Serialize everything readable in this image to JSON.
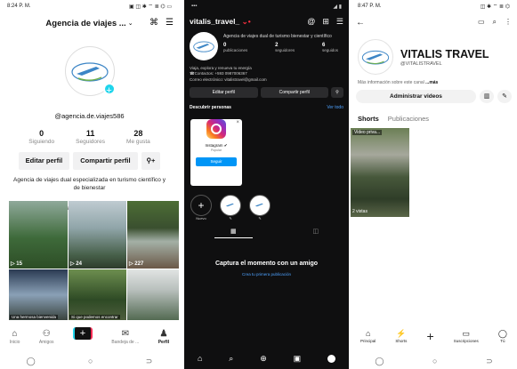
{
  "tiktok": {
    "status_time": "8:24 P. M.",
    "status_right": "▣ ◫ ✱ ⌔ ≣ ⌬ ▭",
    "title": "Agencia de viajes ...",
    "handle": "@agencia.de.viajes586",
    "stats": [
      {
        "value": "0",
        "label": "Siguiendo"
      },
      {
        "value": "11",
        "label": "Seguidores"
      },
      {
        "value": "28",
        "label": "Me gusta"
      }
    ],
    "edit_label": "Editar perfil",
    "share_label": "Compartir perfil",
    "bio": "Agencia de viajes dual especializada en turismo científico y de bienestar",
    "thumbs": [
      {
        "count": "▷ 15",
        "caption": ""
      },
      {
        "count": "▷ 24",
        "caption": ""
      },
      {
        "count": "▷ 227",
        "caption": ""
      },
      {
        "count": "",
        "caption": "Una hermosa bienvenida"
      },
      {
        "count": "",
        "caption": "Si que podemos encontrar"
      },
      {
        "count": "",
        "caption": ""
      }
    ],
    "nav": [
      {
        "icon": "⌂",
        "label": "Inicio"
      },
      {
        "icon": "⚇",
        "label": "Amigos"
      },
      {
        "icon": "✉",
        "label": "Bandeja de ..."
      },
      {
        "icon": "♟",
        "label": "Perfil"
      }
    ]
  },
  "instagram": {
    "username": "vitalis_travel_",
    "bio_name": "Agencia de viajes dual de turismo bienestar y científico",
    "stats": [
      {
        "value": "0",
        "label": "publicaciones"
      },
      {
        "value": "2",
        "label": "seguidores"
      },
      {
        "value": "6",
        "label": "seguidos"
      }
    ],
    "bio_line1": "Viaja, explora y renueva tu energía",
    "bio_line2": "☎Contactos: +593 0987006367",
    "bio_line3": "Correo electrónico: vitalistravel@gmail.com",
    "edit_label": "Editar perfil",
    "share_label": "Compartir perfil",
    "discover_label": "Descubrir personas",
    "see_all_label": "Ver todo",
    "suggested_name": "Instagram ✔",
    "suggested_sub": "Popular",
    "follow_label": "Seguir",
    "new_label": "Nuevo",
    "empty_title": "Captura el momento con un amigo",
    "empty_link": "Crea tu primera publicación"
  },
  "youtube": {
    "status_time": "8:47 P. M.",
    "channel_name": "VITALIS TRAVEL",
    "channel_handle": "@VITALISTRAVEL",
    "more_info": "Más información sobre este canal ",
    "more_info_link": "...más",
    "manage_label": "Administrar videos",
    "tabs": [
      "Shorts",
      "Publicaciones"
    ],
    "short_label": "Video priva...",
    "short_views": "2 vistas",
    "nav": [
      {
        "icon": "⌂",
        "label": "Principal"
      },
      {
        "icon": "⚡",
        "label": "Shorts"
      },
      {
        "icon": "▭",
        "label": "Suscripciones"
      },
      {
        "icon": "◯",
        "label": "Tú"
      }
    ]
  },
  "system_nav": [
    "◯",
    "○",
    "⊃"
  ]
}
